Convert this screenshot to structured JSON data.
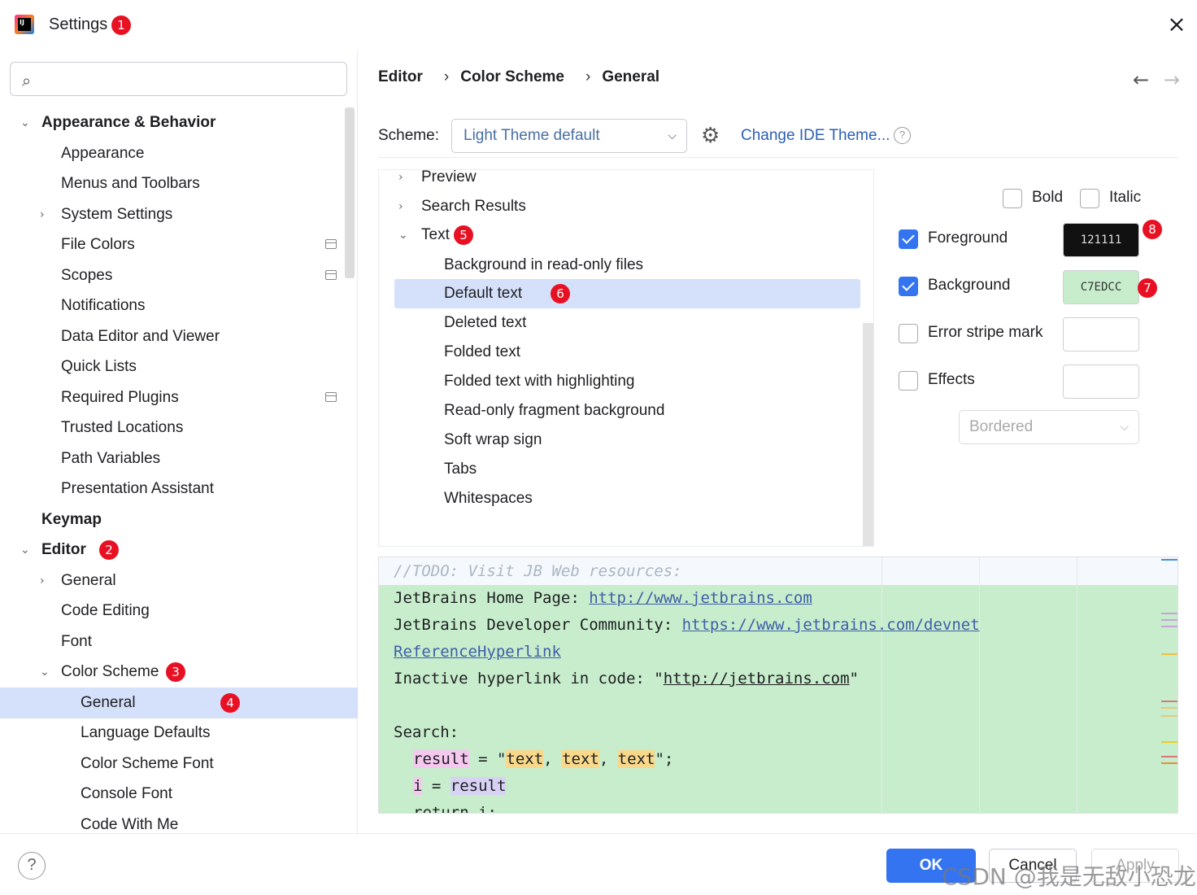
{
  "window": {
    "title": "Settings",
    "title_badge": "1",
    "close_icon": "×",
    "logo_text": "IJ"
  },
  "search": {
    "placeholder": ""
  },
  "tree": [
    {
      "label": "Appearance & Behavior",
      "chev": "⌄",
      "bold": true
    },
    {
      "label": "Appearance"
    },
    {
      "label": "Menus and Toolbars"
    },
    {
      "label": "System Settings",
      "chev": "›"
    },
    {
      "label": "File Colors",
      "doc": true
    },
    {
      "label": "Scopes",
      "doc": true
    },
    {
      "label": "Notifications"
    },
    {
      "label": "Data Editor and Viewer"
    },
    {
      "label": "Quick Lists"
    },
    {
      "label": "Required Plugins",
      "doc": true
    },
    {
      "label": "Trusted Locations"
    },
    {
      "label": "Path Variables"
    },
    {
      "label": "Presentation Assistant"
    },
    {
      "label": "Keymap",
      "bold": true
    },
    {
      "label": "Editor",
      "chev": "⌄",
      "bold": true,
      "badge": "2"
    },
    {
      "label": "General",
      "chev": "›"
    },
    {
      "label": "Code Editing"
    },
    {
      "label": "Font"
    },
    {
      "label": "Color Scheme",
      "chev": "⌄",
      "badge": "3"
    },
    {
      "label": "General",
      "selected": true,
      "badge": "4"
    },
    {
      "label": "Language Defaults"
    },
    {
      "label": "Color Scheme Font"
    },
    {
      "label": "Console Font"
    },
    {
      "label": "Code With Me"
    }
  ],
  "breadcrumb": {
    "items": [
      "Editor",
      "Color Scheme",
      "General"
    ],
    "sep": "›",
    "back": "←",
    "forward": "→"
  },
  "scheme": {
    "label": "Scheme:",
    "value": "Light Theme default",
    "change_link": "Change IDE Theme...",
    "help": "?"
  },
  "attributes": [
    {
      "label": "Preview",
      "chev": "›"
    },
    {
      "label": "Search Results",
      "chev": "›"
    },
    {
      "label": "Text",
      "chev": "⌄",
      "badge": "5"
    },
    {
      "label": "Background in read-only files"
    },
    {
      "label": "Default text",
      "selected": true,
      "badge": "6"
    },
    {
      "label": "Deleted text"
    },
    {
      "label": "Folded text"
    },
    {
      "label": "Folded text with highlighting"
    },
    {
      "label": "Read-only fragment background"
    },
    {
      "label": "Soft wrap sign"
    },
    {
      "label": "Tabs"
    },
    {
      "label": "Whitespaces"
    }
  ],
  "props": {
    "bold": {
      "label": "Bold",
      "checked": false
    },
    "italic": {
      "label": "Italic",
      "checked": false
    },
    "foreground": {
      "label": "Foreground",
      "checked": true,
      "value": "121111",
      "color": "#121111",
      "badge": "8"
    },
    "background": {
      "label": "Background",
      "checked": true,
      "value": "C7EDCC",
      "color": "#c7edcc",
      "badge": "7"
    },
    "error_stripe": {
      "label": "Error stripe mark",
      "checked": false,
      "value": ""
    },
    "effects": {
      "label": "Effects",
      "checked": false,
      "value": ""
    },
    "effect_type": "Bordered"
  },
  "preview": {
    "todo": "//TODO: Visit JB Web resources:",
    "home_label": "JetBrains Home Page: ",
    "home_url": "http://www.jetbrains.com",
    "dev_label": "JetBrains Developer Community: ",
    "dev_url": "https://www.jetbrains.com/devnet",
    "ref": "ReferenceHyperlink",
    "inactive_label": "Inactive hyperlink in code: \"",
    "inactive_url": "http://jetbrains.com",
    "inactive_end": "\"",
    "search_label": "Search:",
    "result_var": "result",
    "assign": " = \"",
    "text1": "text",
    "comma": ", ",
    "text2": "text",
    "text3": "text",
    "end": "\";",
    "i_var": "i",
    "i_assign": " = ",
    "result2": "result",
    "return_line": "return i;"
  },
  "footer": {
    "help": "?",
    "ok": "OK",
    "cancel": "Cancel",
    "apply": "Apply"
  },
  "watermark": "CSDN @我是无敌小恐龙",
  "colors": {
    "accent": "#3574f0",
    "selection": "#d5e0fb",
    "badge": "#e81123",
    "preview_bg": "#c7edcc"
  }
}
